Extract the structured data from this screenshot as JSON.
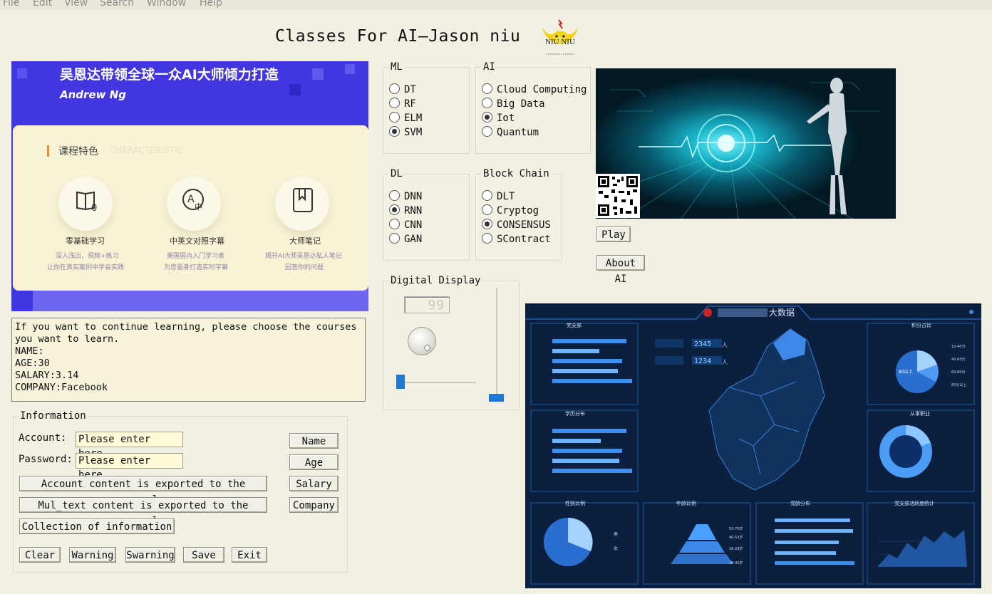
{
  "menu": [
    "File",
    "Edit",
    "View",
    "Search",
    "Window",
    "Help"
  ],
  "title": "Classes For AI—Jason niu",
  "logo_text": "NIU NIU",
  "banner": {
    "headline": "吴恩达带领全球一众AI大师倾力打造",
    "name": "Andrew Ng",
    "section_label": "课程特色",
    "section_label_en": "CHARACTERISTIC",
    "features": [
      {
        "icon": "book-icon",
        "title": "零基础学习",
        "line1": "深入浅出，视频+练习",
        "line2": "让你在真实案例中学会实践"
      },
      {
        "icon": "translate-icon",
        "title": "中英文对照字幕",
        "line1": "美国国内入门学习者",
        "line2": "为您量身打造实时字幕"
      },
      {
        "icon": "bookmark-icon",
        "title": "大师笔记",
        "line1": "揭开AI大师吴恩达私人笔记",
        "line2": "回答你的问题"
      }
    ]
  },
  "textbox": "If you want to continue learning, please choose the courses\nyou want to learn.\nNAME:\nAGE:30\nSALARY:3.14\nCOMPANY:Facebook",
  "info": {
    "title": "Information",
    "account_label": "Account:",
    "password_label": "Password:",
    "account_value": "Please enter here",
    "password_value": "Please enter here",
    "btn_account": "Account content is exported to the console",
    "btn_multext": "Mul_text content is exported to the console",
    "btn_collect": "Collection of information",
    "btn_name": "Name",
    "btn_age": "Age",
    "btn_salary": "Salary",
    "btn_company": "Company",
    "btn_clear": "Clear",
    "btn_warning": "Warning",
    "btn_swarning": "Swarning",
    "btn_save": "Save",
    "btn_exit": "Exit"
  },
  "ml": {
    "title": "ML",
    "options": [
      "DT",
      "RF",
      "ELM",
      "SVM"
    ],
    "selected": "SVM"
  },
  "ai": {
    "title": "AI",
    "options": [
      "Cloud Computing",
      "Big Data",
      "Iot",
      "Quantum"
    ],
    "selected": "Iot"
  },
  "dl": {
    "title": "DL",
    "options": [
      "DNN",
      "RNN",
      "CNN",
      "GAN"
    ],
    "selected": "RNN"
  },
  "blockchain": {
    "title": "Block Chain",
    "options": [
      "DLT",
      "Cryptog",
      "CONSENSUS",
      "SContract"
    ],
    "selected": "CONSENSUS"
  },
  "digital": {
    "title": "Digital Display",
    "lcd": "99",
    "hslider_fraction": 0.0,
    "vslider_fraction": 0.0
  },
  "play_label": "Play",
  "about_label": "About AI",
  "dashboard": {
    "title": "大数据",
    "counter1": "2345",
    "counter1_unit": "人",
    "counter2": "1234",
    "counter2_unit": "人",
    "panels": [
      "党支部",
      "积分占比",
      "学历分布",
      "从事职业",
      "性别比例",
      "年龄比例",
      "党龄分布",
      "党支部活跃度统计"
    ],
    "score_labels": [
      "12-40分",
      "40-60分",
      "60-80分",
      "80分以上"
    ],
    "gender_labels": [
      "男",
      "女"
    ],
    "age_labels": [
      "55-70岁",
      "40-55岁",
      "18-28岁",
      "28-40岁"
    ],
    "bar_colors": [
      "#3d8ef0",
      "#6fb3ff"
    ]
  }
}
